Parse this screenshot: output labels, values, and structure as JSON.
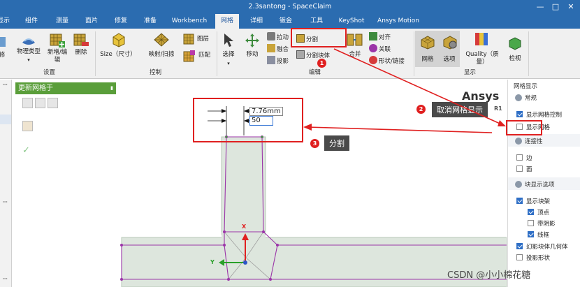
{
  "window": {
    "title": "2.3santong - SpaceClaim",
    "controls": [
      "—",
      "□",
      "✕"
    ]
  },
  "tabs": [
    "显示",
    "组件",
    "测量",
    "面片",
    "修复",
    "准备",
    "Workbench",
    "网格",
    "详细",
    "钣金",
    "工具",
    "KeyShot",
    "Ansys Motion"
  ],
  "active_tab": "网格",
  "ribbon": {
    "groups": {
      "settings": "设置",
      "control": "控制",
      "edit": "编辑",
      "display": "显示"
    },
    "settings_buttons": [
      "修",
      "物理类型",
      "新增/编辑",
      "删除"
    ],
    "control_buttons": [
      "Size（尺寸）",
      "映射/扫掠",
      "图层",
      "匹配"
    ],
    "edit_buttons": [
      "选择",
      "移动",
      "拉动",
      "融合",
      "投影",
      "分割",
      "分割块体",
      "合并",
      "对齐",
      "关联",
      "形状/链接"
    ],
    "display_buttons": [
      "网格",
      "选项",
      "Quality（质量）",
      "检视"
    ]
  },
  "tool_panel": {
    "title": "更新网格于",
    "pin": "▮"
  },
  "viewport": {
    "brand": "Ansys",
    "version": "R1",
    "dimension_value": "7.76mm",
    "input_value": "50",
    "axis_x": "X",
    "axis_y": "Y"
  },
  "right_panel": {
    "title": "网格显示",
    "sections": [
      {
        "label": "常规",
        "items": [
          {
            "label": "显示网格控制",
            "checked": true
          },
          {
            "label": "显示网格",
            "checked": false
          }
        ]
      },
      {
        "label": "连接性",
        "items": [
          {
            "label": "边",
            "checked": false
          },
          {
            "label": "面",
            "checked": false
          }
        ]
      },
      {
        "label": "块显示选项",
        "items": [
          {
            "label": "显示块架",
            "checked": true
          },
          {
            "label": "顶点",
            "checked": true
          },
          {
            "label": "带阴影",
            "checked": false
          },
          {
            "label": "线框",
            "checked": true
          },
          {
            "label": "幻影块体几何体",
            "checked": true
          },
          {
            "label": "投影形状",
            "checked": false
          }
        ]
      }
    ]
  },
  "annotations": [
    {
      "num": "1",
      "text": ""
    },
    {
      "num": "2",
      "text": "取消网格显示"
    },
    {
      "num": "3",
      "text": "分割"
    }
  ],
  "watermark": "CSDN @小小棉花糖",
  "colors": {
    "titlebar": "#2b6cb0",
    "accent_red": "#e02020",
    "panel_green": "#5a9e3a",
    "block_purple": "#9b35a8"
  }
}
